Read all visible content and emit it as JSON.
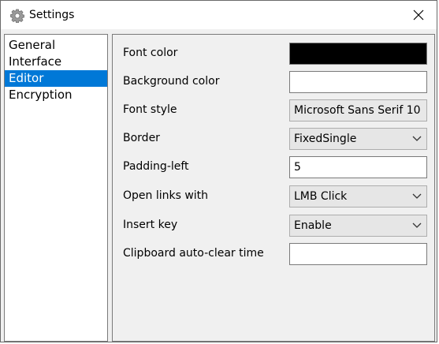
{
  "window": {
    "title": "Settings"
  },
  "nav": {
    "items": [
      {
        "label": "General"
      },
      {
        "label": "Interface"
      },
      {
        "label": "Editor"
      },
      {
        "label": "Encryption"
      }
    ],
    "selected": "Editor"
  },
  "editor": {
    "font_color": {
      "label": "Font color",
      "value_color": "#000000"
    },
    "background_color": {
      "label": "Background color",
      "value_color": "#ffffff"
    },
    "font_style": {
      "label": "Font style",
      "value": "Microsoft Sans Serif 10"
    },
    "border": {
      "label": "Border",
      "value": "FixedSingle"
    },
    "padding_left": {
      "label": "Padding-left",
      "value": "5"
    },
    "open_links_with": {
      "label": "Open links with",
      "value": "LMB Click"
    },
    "insert_key": {
      "label": "Insert key",
      "value": "Enable"
    },
    "clipboard_auto_clear_time": {
      "label": "Clipboard auto-clear time",
      "value": ""
    }
  },
  "colors": {
    "selection": "#0078d7"
  },
  "icons": {
    "title": "gear-icon",
    "close": "close-icon",
    "dropdown": "chevron-down-icon"
  }
}
